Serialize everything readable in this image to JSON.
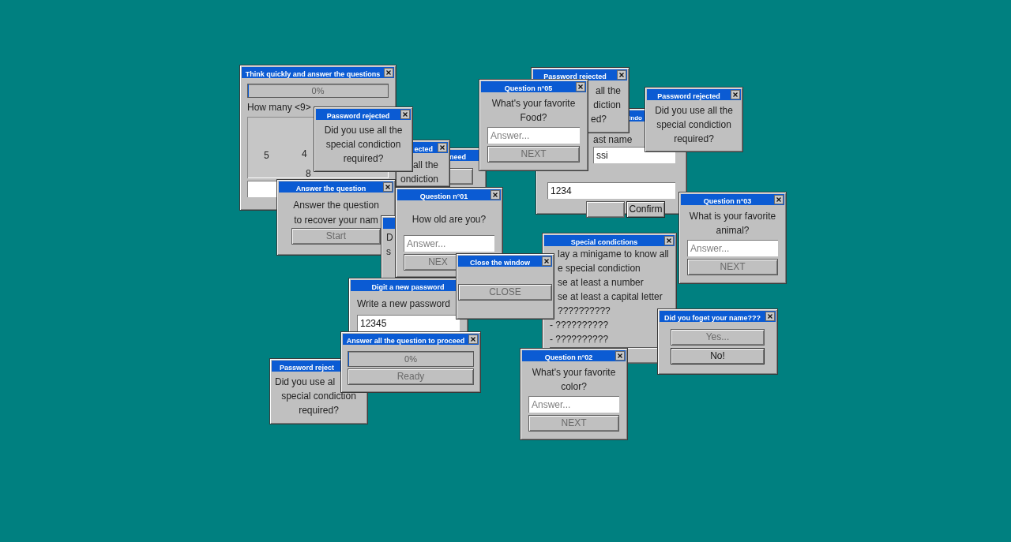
{
  "desktop": {
    "windows": [
      {
        "title": "Think quickly and answer the questions",
        "items": [
          {
            "kind": "progress",
            "label": "0%",
            "level": 0
          },
          {
            "kind": "text",
            "text": "How many <9>"
          },
          {
            "kind": "numbers",
            "values": [
              "5",
              "4",
              "8"
            ]
          },
          {
            "kind": "input"
          }
        ]
      },
      {
        "title": "Password rejected",
        "items": [
          {
            "kind": "text",
            "text": "all the"
          },
          {
            "kind": "text",
            "text": "diction"
          },
          {
            "kind": "text",
            "text": "ed?"
          }
        ]
      },
      {
        "title": "Question n°05",
        "items": [
          {
            "kind": "text",
            "text": "What's your favorite Food?"
          },
          {
            "kind": "input",
            "placeholder": "Answer..."
          },
          {
            "kind": "button",
            "label": "NEXT",
            "disabled": true
          }
        ]
      },
      {
        "title": "Password rejected",
        "items": [
          {
            "kind": "text",
            "text": "Did you use all the"
          },
          {
            "kind": "text",
            "text": "special condiction"
          },
          {
            "kind": "text",
            "text": "required?"
          }
        ]
      },
      {
        "title": "Password rejected",
        "items": [
          {
            "kind": "text",
            "text": "Did you use all the"
          },
          {
            "kind": "text",
            "text": "special condiction"
          },
          {
            "kind": "text",
            "text": "required?"
          }
        ]
      },
      {
        "title": "ected",
        "items": [
          {
            "kind": "text",
            "text": "all the"
          },
          {
            "kind": "text",
            "text": "ondiction"
          }
        ]
      },
      {
        "title": "need",
        "items": [
          {
            "kind": "button",
            "disabled": true
          }
        ]
      },
      {
        "title": "indo",
        "items": [
          {
            "kind": "text",
            "text": "ast name"
          },
          {
            "kind": "input",
            "value": "ssi"
          },
          {
            "kind": "input",
            "value": "1234"
          },
          {
            "kind": "buttons",
            "buttons": [
              {
                "disabled": true
              },
              {
                "label": "Confirm",
                "disabled": false
              }
            ]
          }
        ]
      },
      {
        "title": "Answer the question",
        "items": [
          {
            "kind": "text",
            "text": "Answer the question"
          },
          {
            "kind": "text",
            "text": "to recover your nam"
          },
          {
            "kind": "button",
            "label": "Start",
            "disabled": true
          }
        ]
      },
      {
        "title": "Question n°01",
        "items": [
          {
            "kind": "text",
            "text": "How old are you?"
          },
          {
            "kind": "input",
            "placeholder": "Answer..."
          },
          {
            "kind": "button",
            "label": "NEX",
            "disabled": true
          }
        ]
      },
      {
        "title": "Question n°03",
        "items": [
          {
            "kind": "text",
            "text": "What is your favorite animal?"
          },
          {
            "kind": "input",
            "placeholder": "Answer..."
          },
          {
            "kind": "button",
            "label": "NEXT",
            "disabled": true
          }
        ]
      },
      {
        "items": [
          {
            "kind": "text",
            "text": "D"
          },
          {
            "kind": "text",
            "text": "s"
          }
        ]
      },
      {
        "title": "Special condictions",
        "items": [
          {
            "kind": "text",
            "text": "lay a minigame to know all"
          },
          {
            "kind": "text",
            "text": "e special condiction"
          },
          {
            "kind": "text",
            "text": "se at least a number"
          },
          {
            "kind": "text",
            "text": "se at least a capital letter"
          },
          {
            "kind": "text",
            "text": "??????????"
          },
          {
            "kind": "text",
            "text": "- ??????????"
          },
          {
            "kind": "text",
            "text": "- ??????????"
          },
          {
            "kind": "button",
            "disabled": true
          }
        ]
      },
      {
        "title": "Close the window",
        "items": [
          {
            "kind": "button",
            "label": "CLOSE",
            "disabled": true
          }
        ]
      },
      {
        "title": "Digit a new password",
        "items": [
          {
            "kind": "text",
            "text": "Write a new password"
          },
          {
            "kind": "input",
            "value": "12345"
          }
        ]
      },
      {
        "title": "Did you foget your name???",
        "items": [
          {
            "kind": "button",
            "label": "Yes...",
            "disabled": true
          },
          {
            "kind": "button",
            "label": "No!",
            "disabled": false
          }
        ]
      },
      {
        "title": "Answer all the question to proceed",
        "items": [
          {
            "kind": "progress",
            "label": "0%",
            "level": 0
          },
          {
            "kind": "button",
            "label": "Ready",
            "disabled": true
          }
        ]
      },
      {
        "title": "Password reject",
        "items": [
          {
            "kind": "text",
            "text": "Did you use al"
          },
          {
            "kind": "text",
            "text": "special condiction"
          },
          {
            "kind": "text",
            "text": "required?"
          }
        ]
      },
      {
        "title": "Question n°02",
        "items": [
          {
            "kind": "text",
            "text": "What's your favorite color?"
          },
          {
            "kind": "input",
            "placeholder": "Answer..."
          },
          {
            "kind": "button",
            "label": "NEXT",
            "disabled": true
          }
        ]
      }
    ]
  }
}
